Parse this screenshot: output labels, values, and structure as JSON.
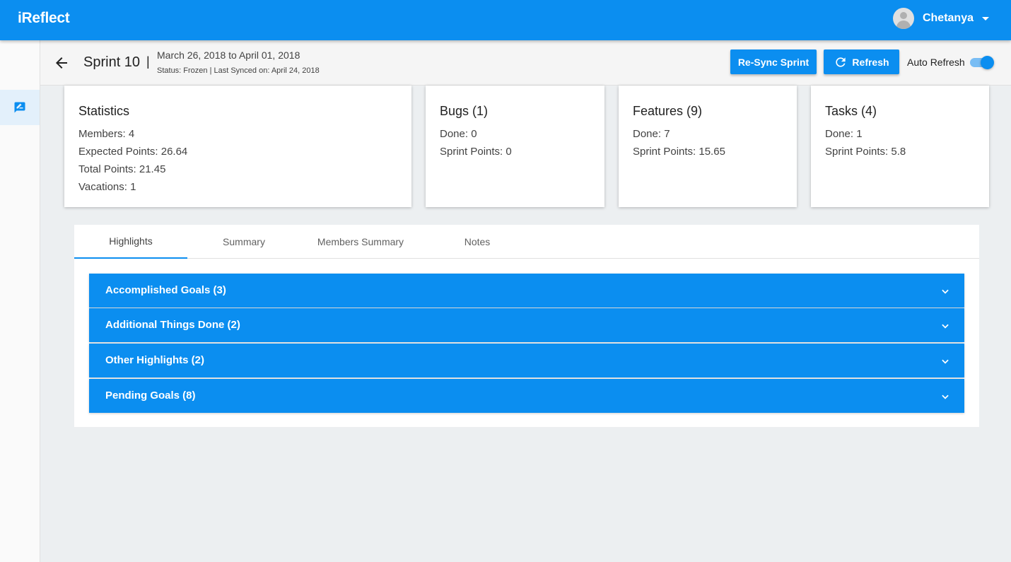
{
  "app": {
    "title": "iReflect"
  },
  "user": {
    "name": "Chetanya"
  },
  "sprint": {
    "title": "Sprint 10",
    "separator": "|",
    "dates": "March 26, 2018 to April 01, 2018",
    "status": "Status: Frozen | Last Synced on: April 24, 2018"
  },
  "toolbar": {
    "resync_label": "Re-Sync Sprint",
    "refresh_label": "Refresh",
    "auto_refresh_label": "Auto Refresh",
    "auto_refresh_on": true
  },
  "cards": {
    "statistics": {
      "title": "Statistics",
      "members": "Members: 4",
      "expected": "Expected Points: 26.64",
      "total": "Total Points: 21.45",
      "vacations": "Vacations: 1"
    },
    "bugs": {
      "title": "Bugs (1)",
      "done": "Done: 0",
      "points": "Sprint Points: 0"
    },
    "features": {
      "title": "Features (9)",
      "done": "Done: 7",
      "points": "Sprint Points: 15.65"
    },
    "tasks": {
      "title": "Tasks (4)",
      "done": "Done: 1",
      "points": "Sprint Points: 5.8"
    }
  },
  "tabs": [
    "Highlights",
    "Summary",
    "Members Summary",
    "Notes"
  ],
  "active_tab": "Highlights",
  "sections": [
    "Accomplished Goals (3)",
    "Additional Things Done (2)",
    "Other Highlights (2)",
    "Pending Goals (8)"
  ],
  "colors": {
    "primary": "#0b8ef0",
    "background": "#eceff1"
  },
  "icons": {
    "sidebar": "rate-review-icon",
    "back": "arrow-back-icon",
    "refresh": "refresh-icon",
    "expand": "chevron-down-icon"
  }
}
